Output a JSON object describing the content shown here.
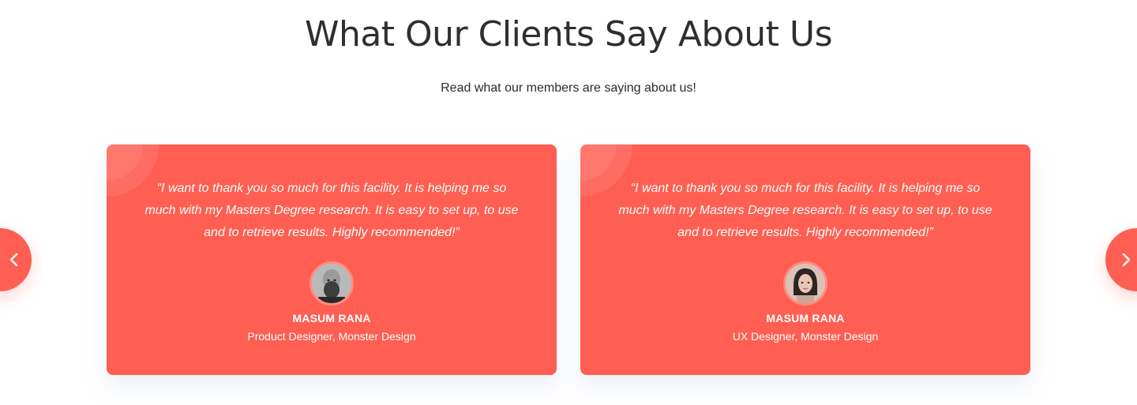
{
  "section": {
    "title": "What Our Clients Say About Us",
    "subtitle": "Read what our members are saying about us!"
  },
  "testimonials": [
    {
      "quote": "“I want to thank you so much for this facility. It is helping me so much with my Masters Degree research. It is easy to set up, to use and to retrieve results. Highly recommended!”",
      "name": "MASUM RANA",
      "role": "Product Designer, Monster Design"
    },
    {
      "quote": "“I want to thank you so much for this facility. It is helping me so much with my Masters Degree research. It is easy to set up, to use and to retrieve results. Highly recommended!”",
      "name": "MASUM RANA",
      "role": "UX Designer, Monster Design"
    }
  ],
  "navigation": {
    "prev_icon": "chevron-left-icon",
    "next_icon": "chevron-right-icon"
  },
  "colors": {
    "accent": "#ff5e52",
    "heading": "#2f2f2f",
    "background": "#ffffff"
  }
}
